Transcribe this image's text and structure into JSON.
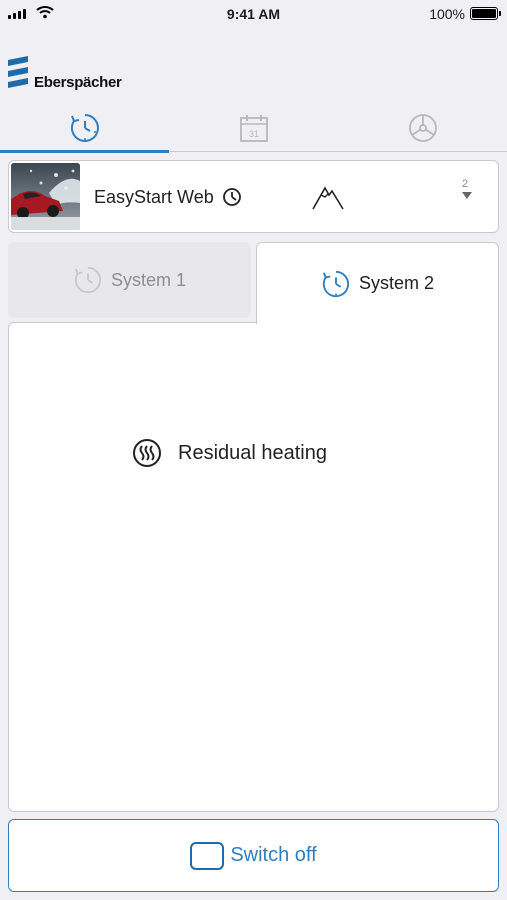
{
  "status_bar": {
    "time": "9:41 AM",
    "battery": "100%"
  },
  "brand": {
    "name": "Eberspächer"
  },
  "nav": {
    "tabs": [
      {
        "icon": "timer-icon",
        "active": true
      },
      {
        "icon": "calendar-icon",
        "day": "31",
        "active": false
      },
      {
        "icon": "steering-wheel-icon",
        "active": false
      }
    ]
  },
  "device": {
    "name": "EasyStart Web",
    "count": "2",
    "icons": [
      "clock-icon",
      "mountain-icon",
      "chevron-down-icon"
    ]
  },
  "systems": {
    "tabs": [
      {
        "label": "System 1",
        "active": false
      },
      {
        "label": "System 2",
        "active": true
      }
    ]
  },
  "mode": {
    "label": "Residual heating",
    "icon": "residual-heat-icon"
  },
  "action": {
    "label": "Switch off"
  },
  "colors": {
    "accent": "#2d7fc1",
    "background": "#efeff4",
    "inactive_text": "#8e8e93"
  }
}
